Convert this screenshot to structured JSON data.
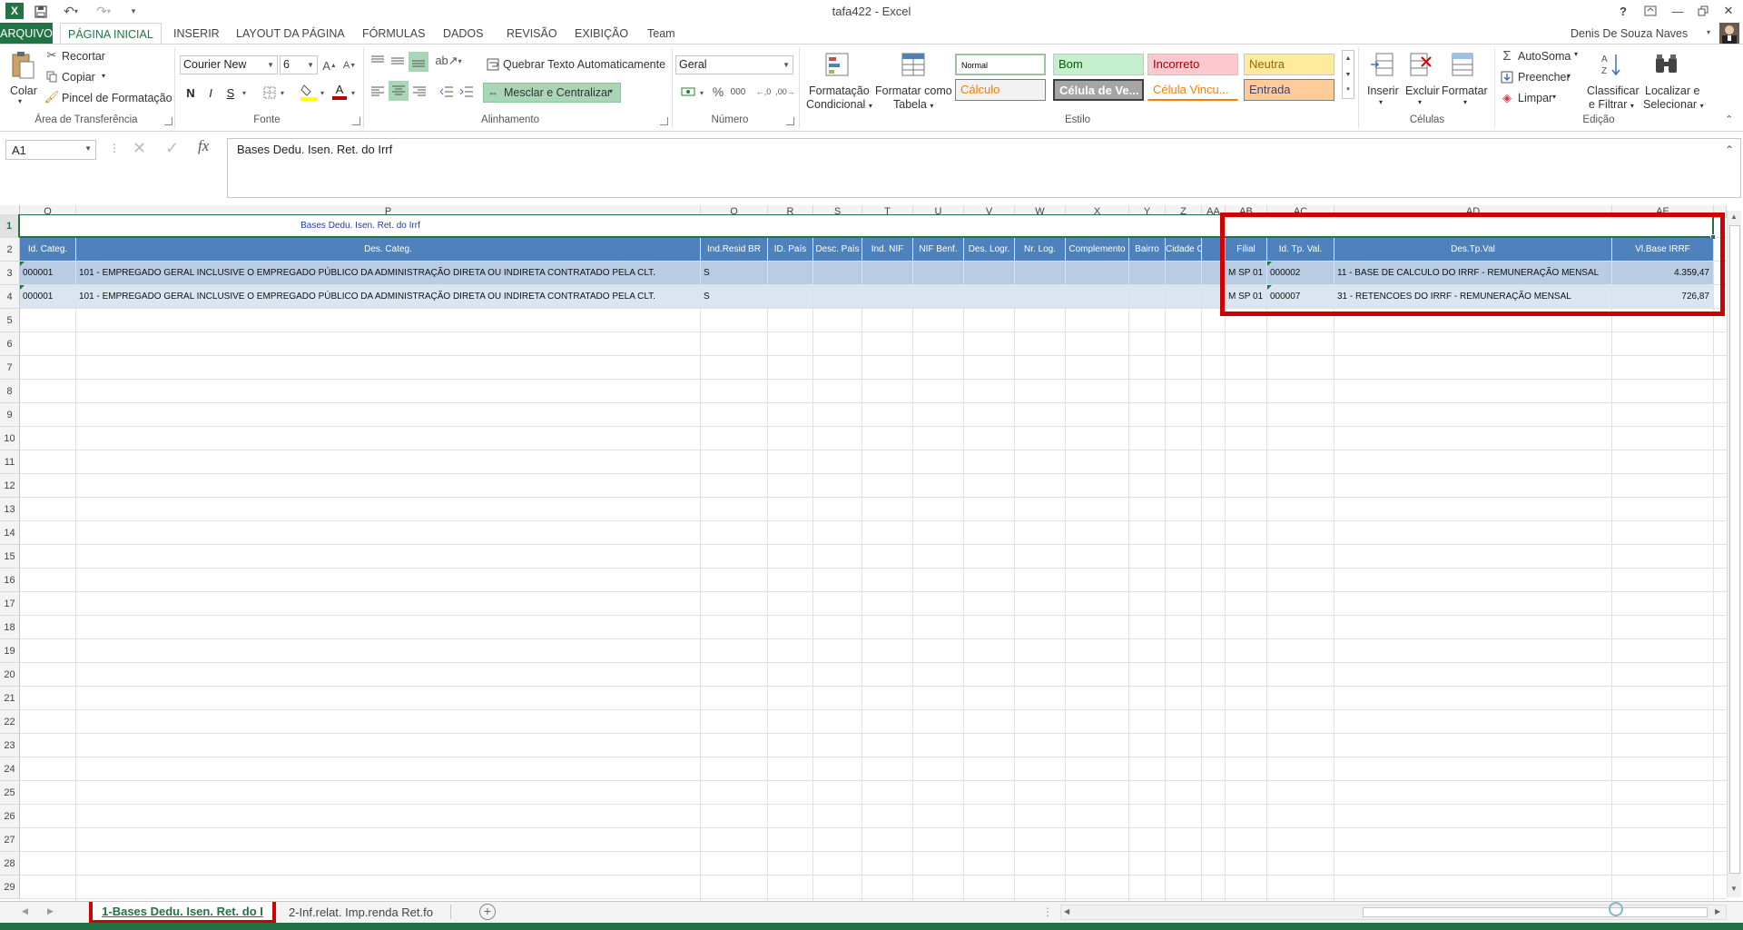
{
  "window": {
    "title": "tafa422 - Excel",
    "help": "?",
    "user": "Denis De Souza Naves"
  },
  "tabs": [
    "ARQUIVO",
    "PÁGINA INICIAL",
    "INSERIR",
    "LAYOUT DA PÁGINA",
    "FÓRMULAS",
    "DADOS",
    "REVISÃO",
    "EXIBIÇÃO",
    "Team"
  ],
  "ribbon": {
    "clipboard": {
      "paste": "Colar",
      "cut": "Recortar",
      "copy": "Copiar",
      "format_painter": "Pincel de Formatação",
      "label": "Área de Transferência"
    },
    "font": {
      "name": "Courier New",
      "size": "6",
      "bold": "N",
      "italic": "I",
      "underline": "S",
      "label": "Fonte"
    },
    "alignment": {
      "wrap": "Quebrar Texto Automaticamente",
      "merge": "Mesclar e Centralizar",
      "label": "Alinhamento"
    },
    "number": {
      "format": "Geral",
      "percent": "%",
      "thousands": "000",
      "label": "Número"
    },
    "styles": {
      "conditional": [
        "Formatação",
        "Condicional"
      ],
      "table": [
        "Formatar como",
        "Tabela"
      ],
      "cells": [
        {
          "label": "Normal",
          "fg": "#000000",
          "bg": "#ffffff",
          "border": "#9bc2a4"
        },
        {
          "label": "Bom",
          "fg": "#006100",
          "bg": "#c6efce",
          "border": "#c6c6c6"
        },
        {
          "label": "Incorreto",
          "fg": "#9c0006",
          "bg": "#ffc7ce",
          "border": "#c6c6c6"
        },
        {
          "label": "Neutra",
          "fg": "#9c6500",
          "bg": "#ffeb9c",
          "border": "#c6c6c6"
        },
        {
          "label": "Cálculo",
          "fg": "#fa7d00",
          "bg": "#f2f2f2",
          "border": "#7f7f7f"
        },
        {
          "label": "Célula de Ve...",
          "fg": "#ffffff",
          "bg": "#a5a5a5",
          "border": "#3f3f3f"
        },
        {
          "label": "Célula Vincu...",
          "fg": "#fa7d00",
          "bg": "#ffffff",
          "border": "#ffffff"
        },
        {
          "label": "Entrada",
          "fg": "#3f3f76",
          "bg": "#ffcc99",
          "border": "#7f7f7f"
        }
      ],
      "label": "Estilo"
    },
    "cells": {
      "insert": "Inserir",
      "delete": "Excluir",
      "format": "Formatar",
      "label": "Células"
    },
    "editing": {
      "autosum": "AutoSoma",
      "fill": "Preencher",
      "clear": "Limpar",
      "sort": [
        "Classificar",
        "e Filtrar"
      ],
      "find": [
        "Localizar e",
        "Selecionar"
      ],
      "label": "Edição"
    }
  },
  "formula_bar": {
    "name_box": "A1",
    "fx": "fx",
    "content": "Bases Dedu. Isen. Ret. do Irrf"
  },
  "grid": {
    "columns": [
      "O",
      "P",
      "Q",
      "R",
      "S",
      "T",
      "U",
      "V",
      "W",
      "X",
      "Y",
      "Z",
      "AA",
      "AB",
      "AC",
      "AD",
      "AE"
    ],
    "rows": [
      "1",
      "2",
      "3",
      "4",
      "5",
      "6",
      "7",
      "8",
      "9",
      "10",
      "11",
      "12",
      "13",
      "14",
      "15",
      "16",
      "17",
      "18",
      "19",
      "20",
      "21",
      "22",
      "23",
      "24",
      "25",
      "26",
      "27",
      "28",
      "29"
    ],
    "title": "Bases Dedu. Isen. Ret. do Irrf",
    "headers": [
      "Id. Categ.",
      "Des. Categ.",
      "Ind.Resid BR",
      "ID. País",
      "Desc. País",
      "Ind. NIF",
      "NIF Benf.",
      "Des. Logr.",
      "Nr. Log.",
      "Complemento",
      "Bairro",
      "Cidade CE",
      "",
      "Filial",
      "Id. Tp. Val.",
      "Des.Tp.Val",
      "Vl.Base IRRF"
    ],
    "data": [
      [
        "000001",
        "101 - EMPREGADO  GERAL INCLUSIVE O EMPREGADO PÚBLICO DA ADMINISTRAÇÃO DIRETA OU INDIRETA CONTRATADO PELA CLT.",
        "S",
        "",
        "",
        "",
        "",
        "",
        "",
        "",
        "",
        "",
        "",
        "M SP 01",
        "000002",
        "11 - BASE DE CALCULO DO IRRF - REMUNERAÇÃO MENSAL",
        "4.359,47"
      ],
      [
        "000001",
        "101 - EMPREGADO  GERAL INCLUSIVE O EMPREGADO PÚBLICO DA ADMINISTRAÇÃO DIRETA OU INDIRETA CONTRATADO PELA CLT.",
        "S",
        "",
        "",
        "",
        "",
        "",
        "",
        "",
        "",
        "",
        "",
        "M SP 01",
        "000007",
        "31 - RETENCOES DO IRRF - REMUNERAÇÃO MENSAL",
        "726,87"
      ]
    ],
    "header_color": "#4f81bd",
    "row_colors": [
      "#b8cce4",
      "#dbe5f1"
    ]
  },
  "sheets": [
    "1-Bases Dedu. Isen. Ret. do I",
    "2-Inf.relat. Imp.renda Ret.fo"
  ],
  "accent": "#217346",
  "highlight": "#d00000"
}
